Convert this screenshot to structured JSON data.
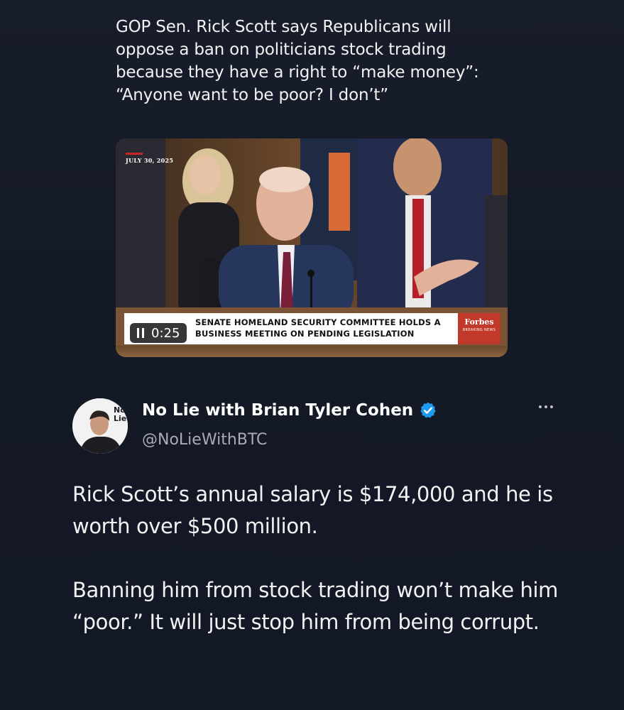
{
  "quoted_tweet": {
    "text": "GOP Sen. Rick Scott says Republicans will oppose a ban on politicians stock trading because they have a right to “make money”: “Anyone want to be poor? I don’t”",
    "video": {
      "date_label": "JULY 30, 2025",
      "time": "0:25",
      "lower_third_line1": "SENATE HOMELAND SECURITY COMMITTEE HOLDS A",
      "lower_third_line2": "BUSINESS MEETING ON PENDING LEGISLATION",
      "brand": "Forbes",
      "brand_sub": "BREAKING NEWS"
    }
  },
  "tweet": {
    "author_name": "No Lie with Brian Tyler Cohen",
    "handle": "@NoLieWithBTC",
    "avatar_text": "No Lie",
    "paragraph1": "Rick Scott’s annual salary is $174,000 and he is worth over $500 million.",
    "paragraph2": "Banning him from stock trading won’t make him “poor.” It will just stop him from being corrupt."
  },
  "colors": {
    "background": "#151a28",
    "verified": "#1d9bf0",
    "forbes_red": "#c0392b"
  },
  "icons": [
    "pause-icon",
    "verified-badge-icon",
    "more-options-icon"
  ]
}
